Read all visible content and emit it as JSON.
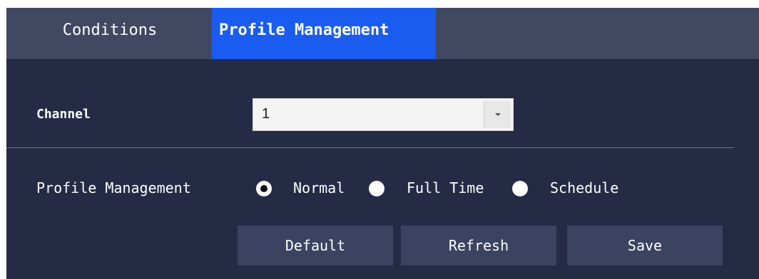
{
  "tabs": [
    {
      "label": "Conditions",
      "active": false
    },
    {
      "label": "Profile Management",
      "active": true
    }
  ],
  "channel": {
    "label": "Channel",
    "selected_value": "1"
  },
  "profile_management": {
    "label": "Profile Management",
    "options": [
      {
        "label": "Normal",
        "selected": true
      },
      {
        "label": "Full Time",
        "selected": false
      },
      {
        "label": "Schedule",
        "selected": false
      }
    ]
  },
  "buttons": {
    "default_label": "Default",
    "refresh_label": "Refresh",
    "save_label": "Save"
  },
  "colors": {
    "panel_bg": "#252b45",
    "tabbar_bg": "#414861",
    "active_tab": "#1a5cf0",
    "button_bg": "#3b4360"
  }
}
